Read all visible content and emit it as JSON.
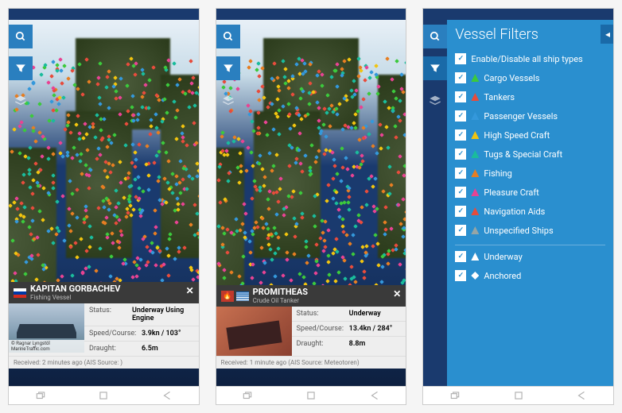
{
  "screens": [
    {
      "vessel": {
        "name": "KAPITAN GORBACHEV",
        "type": "Fishing Vessel",
        "flag": "russia",
        "status_label": "Status:",
        "status_value": "Underway Using Engine",
        "speed_label": "Speed/Course:",
        "speed_value": "3.9kn / 103°",
        "draught_label": "Draught:",
        "draught_value": "6.5m",
        "received": "Received: 2 minutes ago (AIS Source: )",
        "img_credit": "© Ragnar Lyngstöl MarineTraffic.com"
      }
    },
    {
      "vessel": {
        "name": "PROMITHEAS",
        "type": "Crude Oil Tanker",
        "flag": "greece",
        "status_label": "Status:",
        "status_value": "Underway",
        "speed_label": "Speed/Course:",
        "speed_value": "13.4kn / 284°",
        "draught_label": "Draught:",
        "draught_value": "8.8m",
        "received": "Received: 1 minute ago (AIS Source: Meteotoren)"
      }
    }
  ],
  "filters": {
    "title": "Vessel Filters",
    "toggle_all": "Enable/Disable all ship types",
    "types": [
      {
        "label": "Cargo Vessels",
        "color": "#3cc93c"
      },
      {
        "label": "Tankers",
        "color": "#e74c3c"
      },
      {
        "label": "Passenger Vessels",
        "color": "#3498db"
      },
      {
        "label": "High Speed Craft",
        "color": "#f1c40f"
      },
      {
        "label": "Tugs & Special Craft",
        "color": "#1abc9c"
      },
      {
        "label": "Fishing",
        "color": "#e67e22"
      },
      {
        "label": "Pleasure Craft",
        "color": "#e84393"
      },
      {
        "label": "Navigation Aids",
        "color": "#e74c3c"
      },
      {
        "label": "Unspecified Ships",
        "color": "#95a5a6"
      }
    ],
    "status": [
      {
        "label": "Underway",
        "icon": "arrow"
      },
      {
        "label": "Anchored",
        "icon": "diamond"
      }
    ]
  }
}
